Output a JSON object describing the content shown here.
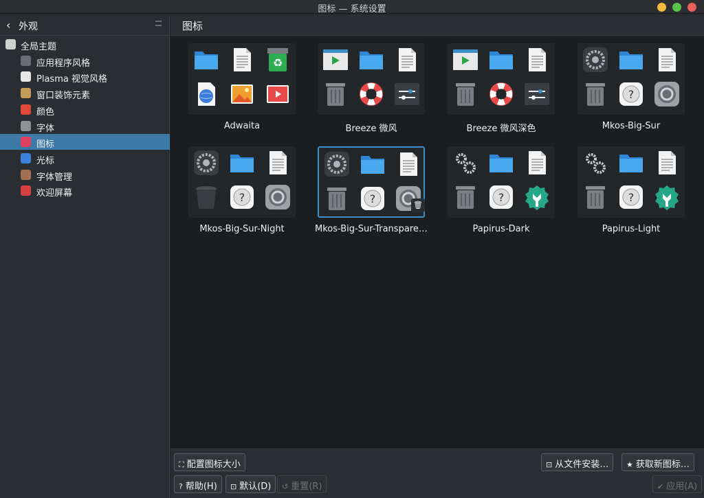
{
  "window": {
    "title": "图标 — 系统设置"
  },
  "sidebar": {
    "back_label": "外观",
    "items": [
      {
        "label": "全局主题",
        "icon": "global-theme-icon"
      },
      {
        "label": "应用程序风格",
        "icon": "app-style-icon"
      },
      {
        "label": "Plasma 视觉风格",
        "icon": "plasma-style-icon"
      },
      {
        "label": "窗口装饰元素",
        "icon": "window-decorations-icon"
      },
      {
        "label": "颜色",
        "icon": "colors-icon"
      },
      {
        "label": "字体",
        "icon": "fonts-icon"
      },
      {
        "label": "图标",
        "icon": "icons-icon"
      },
      {
        "label": "光标",
        "icon": "cursor-icon"
      },
      {
        "label": "字体管理",
        "icon": "font-management-icon"
      },
      {
        "label": "欢迎屏幕",
        "icon": "splash-screen-icon"
      }
    ],
    "selected_index": 6
  },
  "main": {
    "title": "图标"
  },
  "themes": [
    {
      "name": "Adwaita",
      "icons": [
        "folder",
        "text-document",
        "trash-recycle",
        "globe-document",
        "image",
        "video"
      ]
    },
    {
      "name": "Breeze 微风",
      "icons": [
        "window-play",
        "folder",
        "text-document",
        "trash",
        "help-lifebuoy",
        "settings-sliders"
      ]
    },
    {
      "name": "Breeze 微风深色",
      "icons": [
        "window-play",
        "folder",
        "text-document",
        "trash",
        "help-lifebuoy",
        "settings-sliders"
      ]
    },
    {
      "name": "Mkos-Big-Sur",
      "icons": [
        "system-gear",
        "folder",
        "text-document",
        "trash",
        "help-question",
        "preferences-gear"
      ]
    },
    {
      "name": "Mkos-Big-Sur-Night",
      "icons": [
        "system-gear",
        "folder",
        "text-document",
        "trash-dark",
        "help-question",
        "preferences-gear"
      ]
    },
    {
      "name": "Mkos-Big-Sur-Transparet…",
      "icons": [
        "system-gear",
        "folder",
        "text-document",
        "trash",
        "help-question",
        "preferences-gear"
      ]
    },
    {
      "name": "Papirus-Dark",
      "icons": [
        "gears",
        "folder",
        "text-document",
        "trash",
        "help-question",
        "wrench-settings"
      ]
    },
    {
      "name": "Papirus-Light",
      "icons": [
        "gears",
        "folder",
        "text-document",
        "trash",
        "help-question",
        "wrench-settings"
      ]
    }
  ],
  "selected_theme_index": 5,
  "footer": {
    "configure_size": "配置图标大小",
    "install_from_file": "从文件安装…",
    "get_new": "获取新图标…",
    "help": "帮助(H)",
    "defaults": "默认(D)",
    "reset": "重置(R)",
    "apply": "应用(A)"
  },
  "colors": {
    "accent": "#3d7aa8",
    "folder": "#42a5f5",
    "close": "#ec5f5b",
    "minimize": "#f4b93e",
    "maximize": "#5ac34e"
  }
}
